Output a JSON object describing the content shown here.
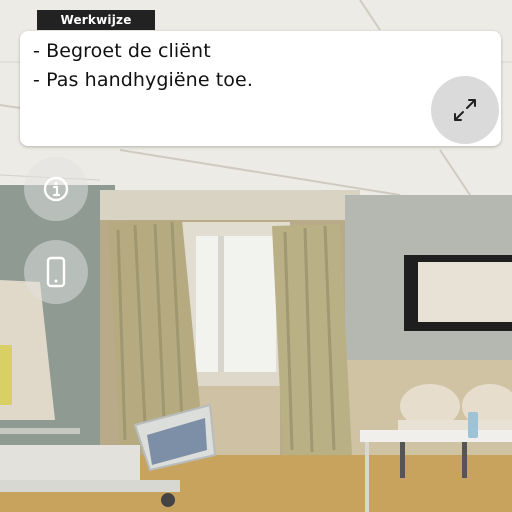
{
  "procedure_panel": {
    "tab_label": "Werkwijze",
    "steps": [
      "- Begroet de cliënt",
      "- Pas handhygiëne toe."
    ],
    "expand_icon": "expand-arrows-icon"
  },
  "side_buttons": [
    {
      "name": "info",
      "icon": "info-icon"
    },
    {
      "name": "phone",
      "icon": "smartphone-icon"
    }
  ],
  "scene": {
    "description_colors": {
      "wall": "#c9bfab",
      "ceiling": "#ecebe6",
      "floor": "#c7a35d",
      "curtain": "#b9b185"
    }
  }
}
